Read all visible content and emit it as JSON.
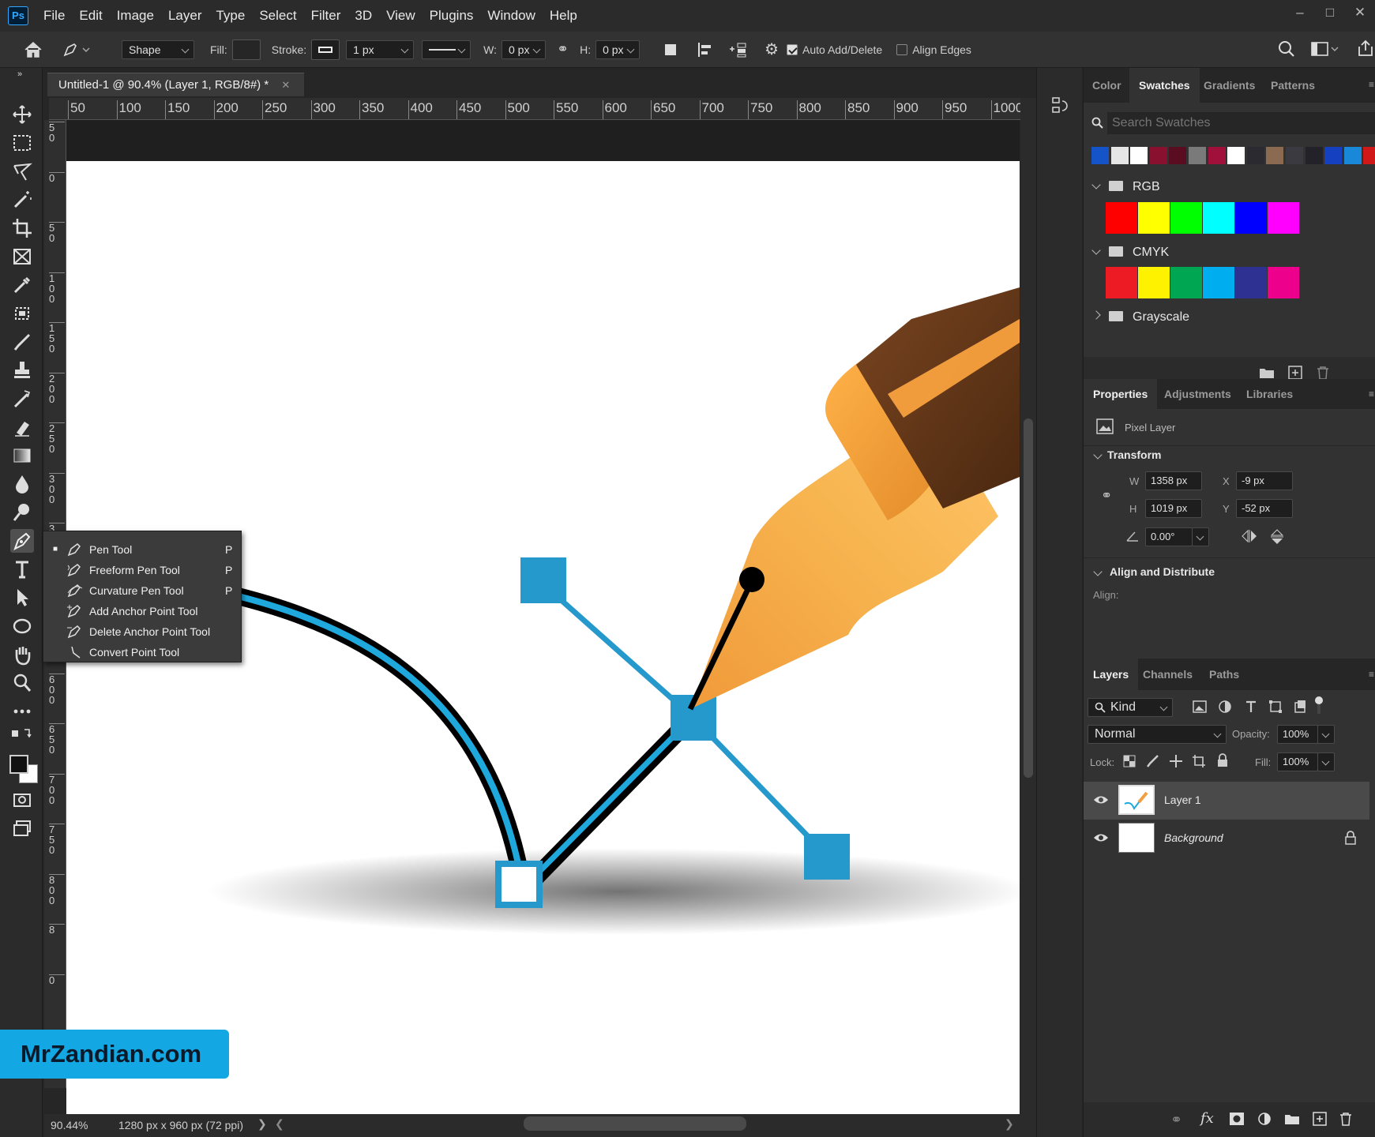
{
  "menubar": {
    "logo": "Ps",
    "items": [
      "File",
      "Edit",
      "Image",
      "Layer",
      "Type",
      "Select",
      "Filter",
      "3D",
      "View",
      "Plugins",
      "Window",
      "Help"
    ]
  },
  "options": {
    "mode": "Shape",
    "fill_label": "Fill:",
    "stroke_label": "Stroke:",
    "stroke_width": "1 px",
    "w_label": "W:",
    "w_value": "0 px",
    "h_label": "H:",
    "h_value": "0 px",
    "auto_add_delete": "Auto Add/Delete",
    "align_edges": "Align Edges"
  },
  "document": {
    "tab_title": "Untitled-1 @ 90.4% (Layer 1, RGB/8#) *",
    "ruler_h": [
      "50",
      "100",
      "150",
      "200",
      "250",
      "300",
      "350",
      "400",
      "450",
      "500",
      "550",
      "600",
      "650",
      "700",
      "750",
      "800",
      "850",
      "900",
      "950",
      "1000"
    ],
    "ruler_v": [
      "5\n0",
      "0",
      "5\n0",
      "1\n0\n0",
      "1\n5\n0",
      "2\n0\n0",
      "2\n5\n0",
      "3\n0\n0",
      "3",
      "5\n0",
      "5\n5\n0",
      "6\n0\n0",
      "6\n5\n0",
      "7\n0\n0",
      "7\n5\n0",
      "8\n0\n0",
      "8",
      "0"
    ],
    "zoom": "90.44%",
    "doc_info": "1280 px x 960 px (72 ppi)"
  },
  "flyout": {
    "items": [
      {
        "label": "Pen Tool",
        "key": "P"
      },
      {
        "label": "Freeform Pen Tool",
        "key": "P"
      },
      {
        "label": "Curvature Pen Tool",
        "key": "P"
      },
      {
        "label": "Add Anchor Point Tool",
        "key": ""
      },
      {
        "label": "Delete Anchor Point Tool",
        "key": ""
      },
      {
        "label": "Convert Point Tool",
        "key": ""
      }
    ]
  },
  "watermark": "MrZandian.com",
  "swatches": {
    "tabs": [
      "Color",
      "Swatches",
      "Gradients",
      "Patterns"
    ],
    "search_placeholder": "Search Swatches",
    "recent": [
      "#1554c8",
      "#e6e6e6",
      "#ffffff",
      "#8a1030",
      "#5a0d20",
      "#7a7a7a",
      "#a0103a",
      "#ffffff",
      "#2a2a30",
      "#8a6a50",
      "#3a3a40",
      "#222228",
      "#1540c0",
      "#1a88d8",
      "#d01818"
    ],
    "groups": [
      {
        "name": "RGB",
        "colors": [
          "#ff0000",
          "#ffff00",
          "#00ff00",
          "#00ffff",
          "#0000ff",
          "#ff00ff"
        ]
      },
      {
        "name": "CMYK",
        "colors": [
          "#ed1c24",
          "#fff200",
          "#00a651",
          "#00aeef",
          "#2e3192",
          "#ec008c"
        ]
      },
      {
        "name": "Grayscale",
        "colors": []
      }
    ]
  },
  "properties": {
    "tabs": [
      "Properties",
      "Adjustments",
      "Libraries"
    ],
    "kind": "Pixel Layer",
    "transform_title": "Transform",
    "w_label": "W",
    "w": "1358 px",
    "x_label": "X",
    "x": "-9 px",
    "h_label": "H",
    "h": "1019 px",
    "y_label": "Y",
    "y": "-52 px",
    "angle": "0.00°",
    "align_title": "Align and Distribute",
    "align_label": "Align:"
  },
  "layers": {
    "tabs": [
      "Layers",
      "Channels",
      "Paths"
    ],
    "filter": "Kind",
    "blend": "Normal",
    "opacity_label": "Opacity:",
    "opacity": "100%",
    "lock_label": "Lock:",
    "fill_label": "Fill:",
    "fill": "100%",
    "items": [
      {
        "name": "Layer 1"
      },
      {
        "name": "Background"
      }
    ]
  },
  "colors": {
    "accent": "#31a8ff",
    "curve_blue": "#1fa8dc",
    "handle_blue": "#2599cc"
  }
}
